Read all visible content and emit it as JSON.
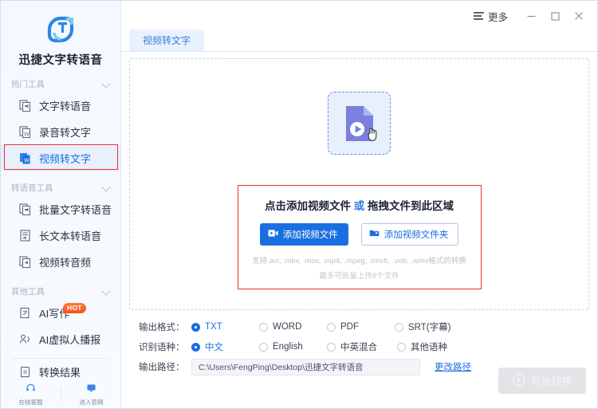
{
  "app": {
    "brand_name": "迅捷文字转语音",
    "logo_icon": "app-logo-icon"
  },
  "titlebar": {
    "more_label": "更多",
    "more_icon": "hamburger-icon",
    "minimize_icon": "minimize-icon",
    "maximize_icon": "maximize-icon",
    "close_icon": "close-icon"
  },
  "sidebar": {
    "sections": [
      {
        "header": "热门工具",
        "chevron_icon": "chevron-down-icon",
        "items": [
          {
            "label": "文字转语音",
            "icon": "text-to-speech-icon",
            "active": false,
            "badge": ""
          },
          {
            "label": "录音转文字",
            "icon": "audio-to-text-icon",
            "active": false,
            "badge": ""
          },
          {
            "label": "视频转文字",
            "icon": "video-to-text-icon",
            "active": true,
            "badge": ""
          }
        ]
      },
      {
        "header": "转语音工具",
        "chevron_icon": "chevron-down-icon",
        "items": [
          {
            "label": "批量文字转语音",
            "icon": "batch-text-to-speech-icon",
            "active": false,
            "badge": ""
          },
          {
            "label": "长文本转语音",
            "icon": "long-text-to-speech-icon",
            "active": false,
            "badge": ""
          },
          {
            "label": "视频转音频",
            "icon": "video-to-audio-icon",
            "active": false,
            "badge": ""
          }
        ]
      },
      {
        "header": "其他工具",
        "chevron_icon": "chevron-down-icon",
        "items": [
          {
            "label": "AI写作",
            "icon": "ai-writing-icon",
            "active": false,
            "badge": "HOT"
          },
          {
            "label": "AI虚拟人播报",
            "icon": "ai-avatar-broadcast-icon",
            "active": false,
            "badge": ""
          }
        ]
      }
    ],
    "result_item": {
      "label": "转换结果",
      "icon": "conversion-result-icon"
    },
    "footer": [
      {
        "label": "在线客服",
        "icon": "headset-icon"
      },
      {
        "label": "进入官网",
        "icon": "monitor-icon"
      }
    ]
  },
  "main": {
    "tabs": [
      {
        "label": "视频转文字",
        "active": true
      }
    ],
    "dropzone": {
      "file_icon": "video-file-icon",
      "cursor_icon": "hand-cursor-icon",
      "title_prefix": "点击添加视频文件 ",
      "title_or": "或",
      "title_suffix": " 拖拽文件到此区域",
      "buttons": [
        {
          "label": "添加视频文件",
          "icon": "add-video-file-icon",
          "style": "primary"
        },
        {
          "label": "添加视频文件夹",
          "icon": "add-video-folder-icon",
          "style": "outline"
        }
      ],
      "hint": "支持.avi, .mkv, .mov, .mp4, .mpeg, .rmvb, .vob, .wmv格式的转换",
      "hint2": "最多可批量上传8个文件"
    }
  },
  "settings": {
    "output_format": {
      "label": "输出格式：",
      "options": [
        {
          "label": "TXT",
          "selected": true
        },
        {
          "label": "WORD",
          "selected": false
        },
        {
          "label": "PDF",
          "selected": false
        },
        {
          "label": "SRT(字幕)",
          "selected": false
        }
      ]
    },
    "recognize_language": {
      "label": "识别语种：",
      "options": [
        {
          "label": "中文",
          "selected": true
        },
        {
          "label": "English",
          "selected": false
        },
        {
          "label": "中英混合",
          "selected": false
        },
        {
          "label": "其他语种",
          "selected": false
        }
      ]
    },
    "output_path": {
      "label": "输出路径：",
      "value": "C:\\Users\\FengPing\\Desktop\\迅捷文字转语音",
      "change_link": "更改路径"
    },
    "start_button": {
      "label": "开始转换",
      "icon": "play-circle-icon",
      "disabled": true
    }
  },
  "colors": {
    "accent": "#1a6fe0",
    "highlight_border": "#e8332a",
    "sidebar_bg": "#f5f9ff",
    "tile": "#7a7fe0",
    "hot_badge": "#f4521d"
  }
}
